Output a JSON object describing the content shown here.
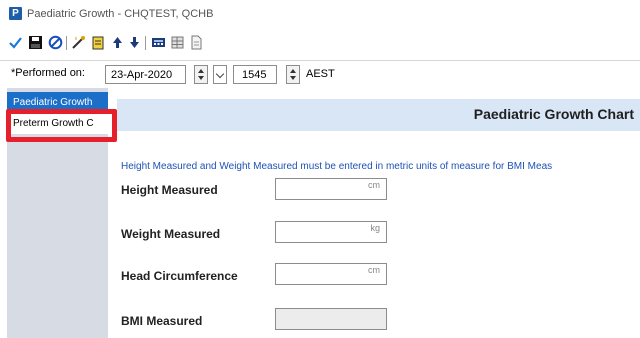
{
  "window": {
    "app_icon_letter": "P",
    "title": "Paediatric Growth - CHQTEST, QCHB"
  },
  "toolbar": {
    "buttons": [
      "check-icon",
      "save-icon",
      "cancel-icon",
      "wand-icon",
      "notes-icon",
      "arrow-up-icon",
      "arrow-down-icon",
      "calculator-icon",
      "table-icon",
      "document-icon"
    ]
  },
  "performed": {
    "label": "*Performed on:",
    "date": "23-Apr-2020",
    "time": "1545",
    "timezone": "AEST"
  },
  "sidebar": {
    "items": [
      {
        "label": "Paediatric Growth"
      },
      {
        "label": "Preterm Growth C"
      }
    ]
  },
  "main": {
    "title": "Paediatric Growth Chart",
    "instruction": "Height Measured and Weight Measured must be entered in metric units of measure for BMI Meas",
    "fields": [
      {
        "label": "Height Measured",
        "unit": "cm"
      },
      {
        "label": "Weight Measured",
        "unit": "kg"
      },
      {
        "label": "Head Circumference",
        "unit": "cm"
      },
      {
        "label": "BMI Measured",
        "unit": ""
      }
    ]
  },
  "colors": {
    "accent": "#1b6fc8",
    "highlight": "#e6202a",
    "header_bg": "#d9e6f6",
    "instruction": "#1d52b6"
  }
}
